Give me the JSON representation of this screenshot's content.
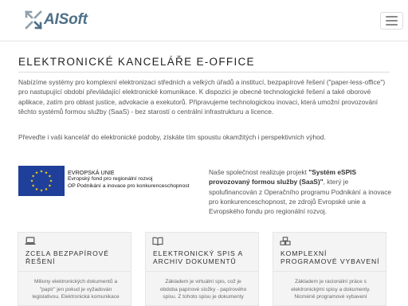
{
  "header": {
    "brand": "AISoft",
    "menu_button_label": "Menu"
  },
  "page_title": "ELEKTRONICKÉ KANCELÁŘE E-OFFICE",
  "intro": {
    "paragraph_1": "Nabízíme systémy pro komplexní elektronizaci středních a velkých úřadů a institucí, bezpapírové řešení (\"paper-less-office\") pro nastupující období převládající elektronické komunikace. K dispozici je obecné technologické řešení a také oborové aplikace, zatím pro oblast justice, advokacie a exekutorů. Připravujeme technologickou inovaci, která umožní provozování těchto systémů formou služby (SaaS) - bez starostí o centrální infrastrukturu a licence.",
    "paragraph_2": "Převeďte i vaši kancelář do elektronické podoby, získáte tím spoustu okamžitých i perspektivních výhod."
  },
  "eu_logo": {
    "line_1": "EVROPSKÁ UNIE",
    "line_2": "Evropský fond pro regionální rozvoj",
    "line_3": "OP Podnikání a inovace pro konkurenceschopnost",
    "flag_color": "#1f3f9a",
    "star_color": "#ffdd00"
  },
  "partner": {
    "text_before": "Naše společnost realizuje projekt ",
    "project_name": "\"Systém eSPIS provozovaný formou služby (SaaS)\"",
    "text_after": ", který je spolufinancován z Operačního programu Podnikání a inovace pro konkurenceschopnost, ze zdrojů Evropské unie a Evropského fondu pro regionální rozvoj."
  },
  "features": [
    {
      "icon": "laptop-icon",
      "title_line_1": "ZCELA BEZPAPÍROVÉ",
      "title_line_2": "ŘEŠENÍ",
      "text_line_1": "Miliony elektronických dokumentů a",
      "text_line_2": "\"papír\" jen pokud je vyžadován",
      "text_line_3": "legislativou. Elektronická komunikace"
    },
    {
      "icon": "book-icon",
      "title_line_1": "ELEKTRONICKÝ SPIS A",
      "title_line_2": "ARCHIV DOKUMENTŮ",
      "text_line_1": "Základem je virtuální spis, což je",
      "text_line_2": "obdoba papírové složky - papírového",
      "text_line_3": "spisu. Z tohoto spisu je dokumenty"
    },
    {
      "icon": "cubes-icon",
      "title_line_1": "KOMPLEXNÍ",
      "title_line_2": "PROGRAMOVÉ VYBAVENÍ",
      "text_line_1": "Základem je racionální práce s",
      "text_line_2": "elektronickými spisy a dokumenty.",
      "text_line_3": "Nicméně programové vybavení"
    }
  ],
  "colors": {
    "brand": "#4d6f87",
    "panel_bg": "#f4f4f4",
    "title_text": "#222222",
    "body_text": "#555555"
  }
}
